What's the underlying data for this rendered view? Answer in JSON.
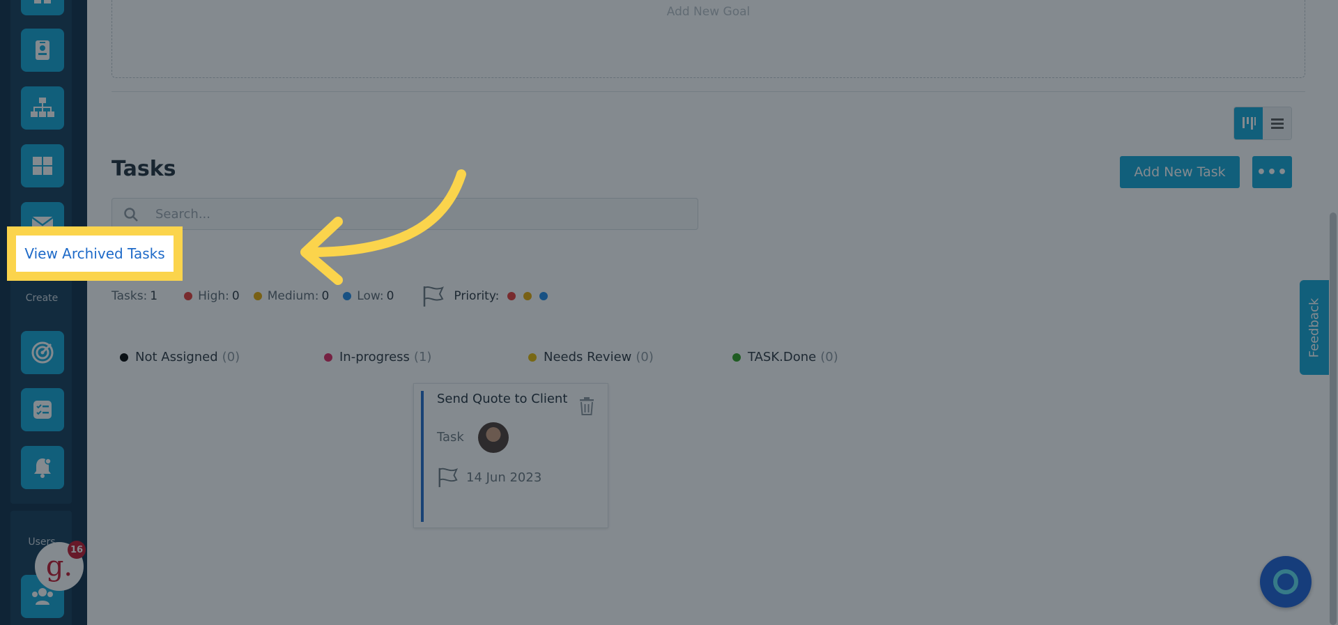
{
  "sidebar": {
    "create_label": "Create",
    "users_label": "Users",
    "icons": [
      "dashboard-icon",
      "contact-card-icon",
      "org-chart-icon",
      "grid-icon",
      "mail-icon",
      "target-icon",
      "checklist-icon",
      "bell-icon",
      "users-icon"
    ]
  },
  "goals": {
    "add_goal_label": "Add New Goal"
  },
  "tasks": {
    "title": "Tasks",
    "add_task_label": "Add New Task",
    "more_label": "•••",
    "search_placeholder": "Search...",
    "archived_link": "View Archived Tasks",
    "stats": {
      "tasks_label": "Tasks:",
      "tasks_count": "1",
      "high_label": "High:",
      "high_count": "0",
      "medium_label": "Medium:",
      "medium_count": "0",
      "low_label": "Low:",
      "low_count": "0",
      "priority_label": "Priority:"
    },
    "columns": [
      {
        "label": "Not Assigned",
        "count": "(0)",
        "color": "#000000"
      },
      {
        "label": "In-progress",
        "count": "(1)",
        "color": "#e0245e"
      },
      {
        "label": "Needs Review",
        "count": "(0)",
        "color": "#e6b800"
      },
      {
        "label": "TASK.Done",
        "count": "(0)",
        "color": "#2ca01c"
      }
    ],
    "card": {
      "title": "Send Quote to Client",
      "type": "Task",
      "date": "14 Jun 2023"
    }
  },
  "feedback_label": "Feedback",
  "grammarly_badge": {
    "letter": "g.",
    "count": "16"
  },
  "colors": {
    "accent": "#0fa5d6",
    "highlight": "#fbd44c",
    "link": "#1e6ac8",
    "high": "#e53935",
    "medium": "#e6a800",
    "low": "#1e88e5"
  }
}
